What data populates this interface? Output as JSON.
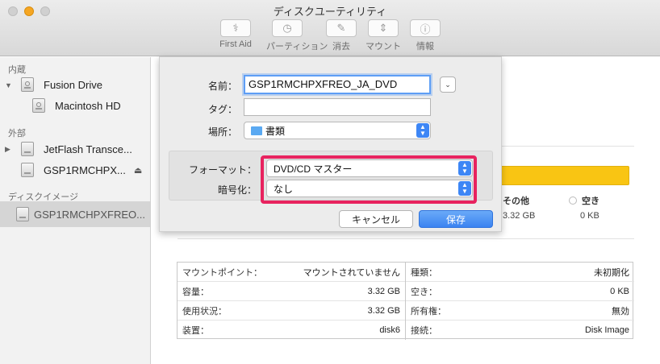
{
  "window": {
    "title": "ディスクユーティリティ"
  },
  "toolbar": {
    "items": [
      {
        "label": "First Aid",
        "icon": "stethoscope-icon",
        "glyph": "⚕"
      },
      {
        "label": "パーティション",
        "icon": "partition-icon",
        "glyph": "◷"
      },
      {
        "label": "消去",
        "icon": "erase-icon",
        "glyph": "✎"
      },
      {
        "label": "マウント",
        "icon": "mount-icon",
        "glyph": "⇕"
      },
      {
        "label": "情報",
        "icon": "info-icon",
        "glyph": "ⓘ"
      }
    ]
  },
  "sidebar": {
    "sections": {
      "internal": "内蔵",
      "external": "外部",
      "images": "ディスクイメージ"
    },
    "items": [
      {
        "label": "Fusion Drive",
        "icon": "hard-drive-icon"
      },
      {
        "label": "Macintosh HD",
        "icon": "volume-icon"
      },
      {
        "label": "JetFlash Transce...",
        "icon": "external-drive-icon"
      },
      {
        "label": "GSP1RMCHPX...",
        "icon": "volume-icon",
        "eject": "⏏"
      },
      {
        "label": "GSP1RMCHPXFREO...",
        "icon": "disk-image-icon"
      }
    ]
  },
  "usage": {
    "other_label": "その他",
    "other_value": "3.32 GB",
    "free_label": "空き",
    "free_value": "0 KB",
    "color": "#f9c513"
  },
  "info": {
    "left": [
      {
        "label": "マウントポイント：",
        "value": "マウントされていません"
      },
      {
        "label": "容量：",
        "value": "3.32 GB"
      },
      {
        "label": "使用状況：",
        "value": "3.32 GB"
      },
      {
        "label": "装置：",
        "value": "disk6"
      }
    ],
    "right": [
      {
        "label": "種類：",
        "value": "未初期化"
      },
      {
        "label": "空き：",
        "value": "0 KB"
      },
      {
        "label": "所有権：",
        "value": "無効"
      },
      {
        "label": "接続：",
        "value": "Disk Image"
      }
    ]
  },
  "dialog": {
    "name_label": "名前：",
    "name_value": "GSP1RMCHPXFREO_JA_DVD",
    "tag_label": "タグ：",
    "tag_value": "",
    "location_label": "場所：",
    "location_value": "書類",
    "format_label": "フォーマット：",
    "format_value": "DVD/CD マスター",
    "encryption_label": "暗号化：",
    "encryption_value": "なし",
    "cancel_label": "キャンセル",
    "save_label": "保存",
    "highlight_color": "#e8235f",
    "accent_color": "#3d86f5"
  }
}
